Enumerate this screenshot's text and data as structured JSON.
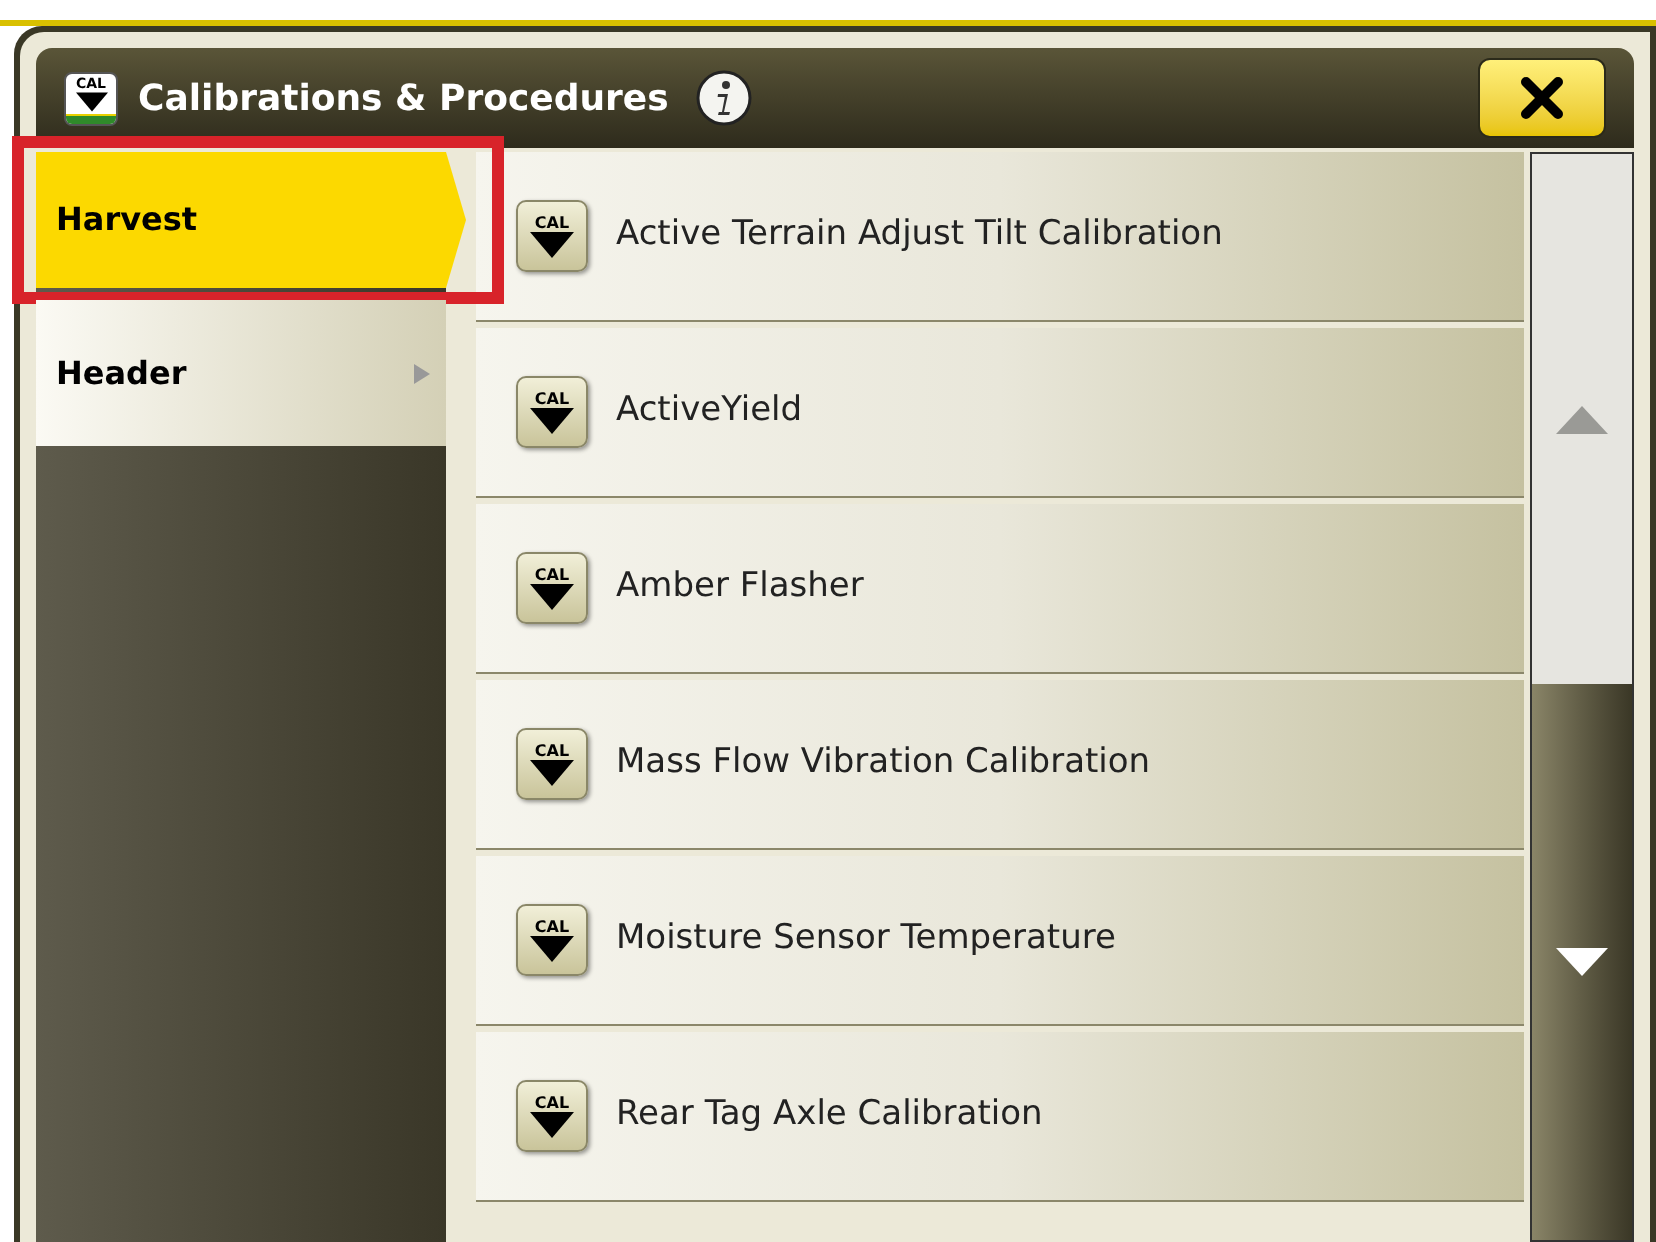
{
  "window": {
    "title": "Calibrations & Procedures",
    "title_icon_label": "CAL"
  },
  "sidebar": {
    "items": [
      {
        "label": "Harvest",
        "selected": true,
        "highlighted": true
      },
      {
        "label": "Header",
        "selected": false,
        "highlighted": false
      }
    ]
  },
  "procedures": [
    {
      "icon_label": "CAL",
      "label": "Active Terrain Adjust Tilt Calibration"
    },
    {
      "icon_label": "CAL",
      "label": "ActiveYield"
    },
    {
      "icon_label": "CAL",
      "label": "Amber Flasher"
    },
    {
      "icon_label": "CAL",
      "label": "Mass Flow Vibration Calibration"
    },
    {
      "icon_label": "CAL",
      "label": "Moisture Sensor Temperature"
    },
    {
      "icon_label": "CAL",
      "label": "Rear Tag Axle Calibration"
    }
  ]
}
